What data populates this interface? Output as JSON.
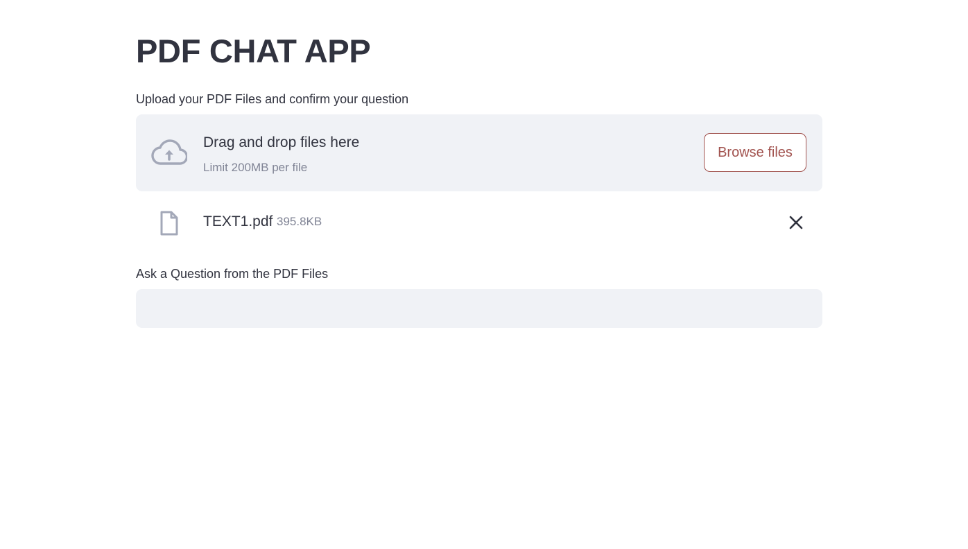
{
  "app": {
    "title": "PDF CHAT APP"
  },
  "uploader": {
    "label": "Upload your PDF Files and confirm your question",
    "dropzone_title": "Drag and drop files here",
    "dropzone_limit": "Limit 200MB per file",
    "browse_label": "Browse files",
    "icon": "cloud-upload-icon",
    "files": [
      {
        "name": "TEXT1.pdf",
        "size": "395.8KB",
        "icon": "file-icon",
        "remove_icon": "close-icon"
      }
    ]
  },
  "question": {
    "label": "Ask a Question from the PDF Files",
    "value": "",
    "placeholder": ""
  },
  "colors": {
    "accent": "#a1524e",
    "text": "#31333f",
    "muted": "#808495",
    "panel": "#f0f2f6"
  }
}
